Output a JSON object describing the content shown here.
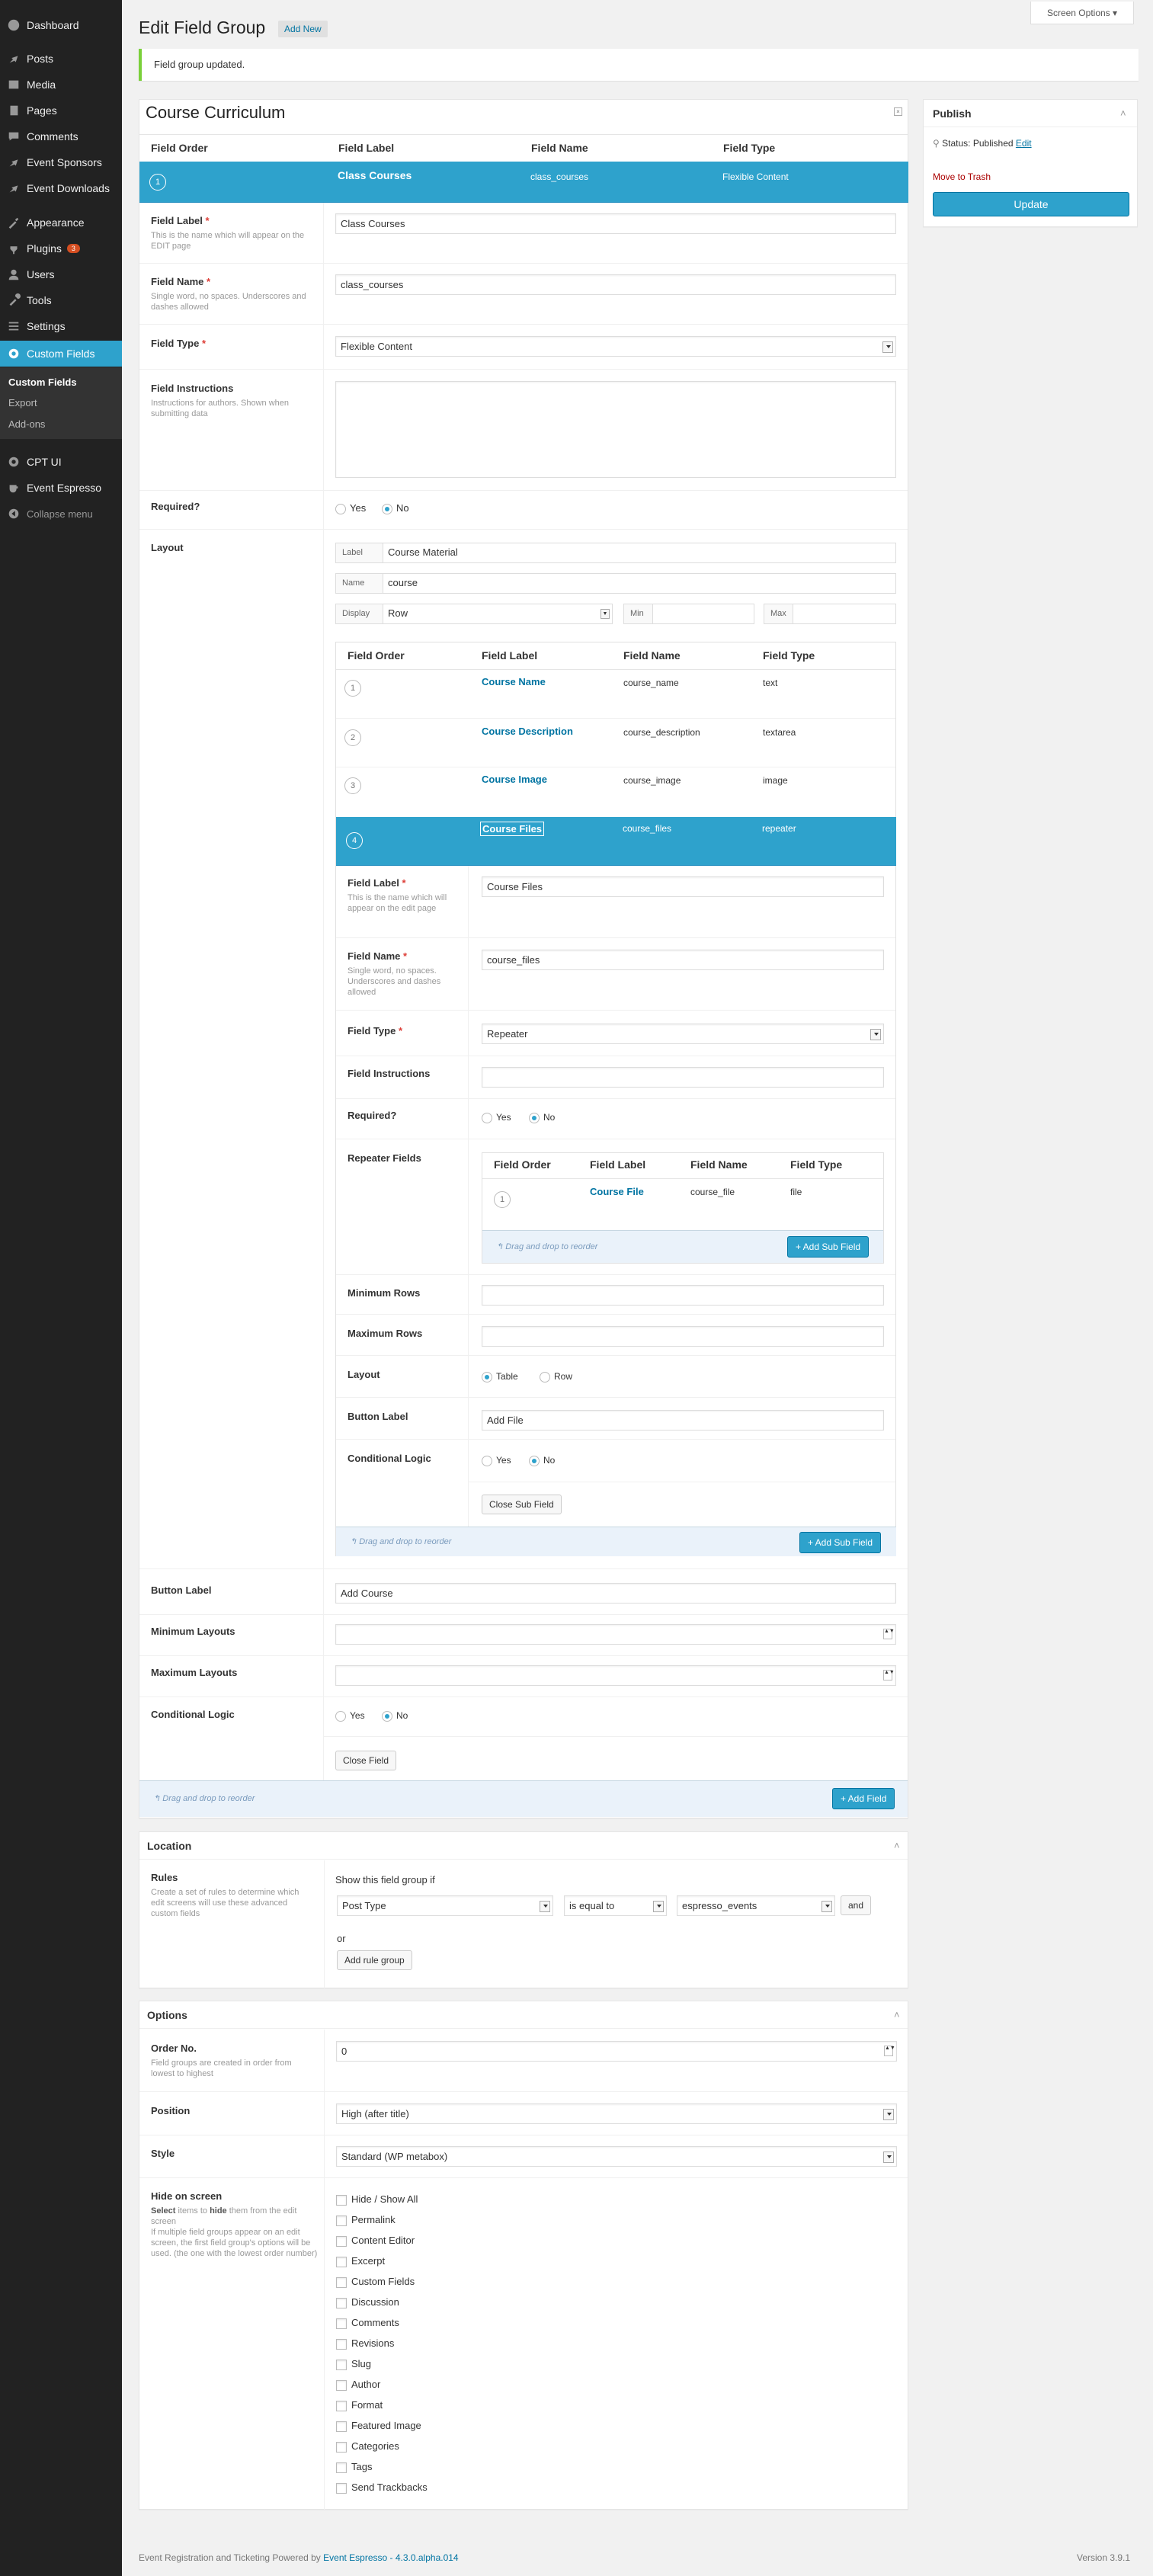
{
  "menu": {
    "items": [
      {
        "label": "Dashboard",
        "icon": "dashboard-icon"
      },
      {
        "label": "Posts",
        "icon": "pin-icon"
      },
      {
        "label": "Media",
        "icon": "media-icon"
      },
      {
        "label": "Pages",
        "icon": "pages-icon"
      },
      {
        "label": "Comments",
        "icon": "comments-icon"
      },
      {
        "label": "Event Sponsors",
        "icon": "pin-icon"
      },
      {
        "label": "Event Downloads",
        "icon": "pin-icon"
      },
      {
        "label": "Appearance",
        "icon": "appearance-icon"
      },
      {
        "label": "Plugins",
        "icon": "plugins-icon",
        "badge": "3"
      },
      {
        "label": "Users",
        "icon": "users-icon"
      },
      {
        "label": "Tools",
        "icon": "tools-icon"
      },
      {
        "label": "Settings",
        "icon": "settings-icon"
      },
      {
        "label": "Custom Fields",
        "icon": "gear-icon"
      },
      {
        "label": "CPT UI",
        "icon": "gear-icon"
      },
      {
        "label": "Event Espresso",
        "icon": "espresso-icon"
      },
      {
        "label": "Collapse menu",
        "icon": "collapse-icon"
      }
    ],
    "sub": [
      "Custom Fields",
      "Export",
      "Add-ons"
    ]
  },
  "header": {
    "title": "Edit Field Group",
    "add_new": "Add New",
    "screen_options": "Screen Options"
  },
  "notice": "Field group updated.",
  "group_title": "Course Curriculum",
  "fields_table": {
    "headers": [
      "Field Order",
      "Field Label",
      "Field Name",
      "Field Type"
    ],
    "row": {
      "order": "1",
      "label": "Class Courses",
      "name": "class_courses",
      "type": "Flexible Content"
    }
  },
  "field": {
    "label_lbl": "Field Label",
    "label_desc": "This is the name which will appear on the EDIT page",
    "label_val": "Class Courses",
    "name_lbl": "Field Name",
    "name_desc": "Single word, no spaces. Underscores and dashes allowed",
    "name_val": "class_courses",
    "type_lbl": "Field Type",
    "type_val": "Flexible Content",
    "instr_lbl": "Field Instructions",
    "instr_desc": "Instructions for authors. Shown when submitting data",
    "required_lbl": "Required?",
    "yes": "Yes",
    "no": "No",
    "layout_lbl": "Layout",
    "layout_label_lbl": "Label",
    "layout_label_val": "Course Material",
    "layout_name_lbl": "Name",
    "layout_name_val": "course",
    "display_lbl": "Display",
    "display_val": "Row",
    "min_lbl": "Min",
    "max_lbl": "Max",
    "sub_fields": [
      {
        "order": "1",
        "label": "Course Name",
        "name": "course_name",
        "type": "text"
      },
      {
        "order": "2",
        "label": "Course Description",
        "name": "course_description",
        "type": "textarea"
      },
      {
        "order": "3",
        "label": "Course Image",
        "name": "course_image",
        "type": "image"
      },
      {
        "order": "4",
        "label": "Course Files",
        "name": "course_files",
        "type": "repeater"
      }
    ],
    "sub": {
      "label_lbl": "Field Label",
      "label_desc": "This is the name which will appear on the edit page",
      "label_val": "Course Files",
      "name_lbl": "Field Name",
      "name_desc": "Single word, no spaces. Underscores and dashes allowed",
      "name_val": "course_files",
      "type_lbl": "Field Type",
      "type_val": "Repeater",
      "instr_lbl": "Field Instructions",
      "required_lbl": "Required?",
      "repeater_lbl": "Repeater Fields",
      "rep_row": {
        "order": "1",
        "label": "Course File",
        "name": "course_file",
        "type": "file"
      },
      "drag": "Drag and drop to reorder",
      "add_sub": "+ Add Sub Field",
      "min_rows": "Minimum Rows",
      "max_rows": "Maximum Rows",
      "layout_lbl": "Layout",
      "table": "Table",
      "row": "Row",
      "button_lbl": "Button Label",
      "button_val": "Add File",
      "cond_lbl": "Conditional Logic",
      "close": "Close Sub Field"
    },
    "drag": "Drag and drop to reorder",
    "add_sub": "+ Add Sub Field",
    "button_lbl": "Button Label",
    "button_val": "Add Course",
    "min_layouts": "Minimum Layouts",
    "max_layouts": "Maximum Layouts",
    "cond_lbl": "Conditional Logic",
    "close": "Close Field"
  },
  "group_footer": {
    "drag": "Drag and drop to reorder",
    "add_field": "+ Add Field"
  },
  "location": {
    "title": "Location",
    "rules_lbl": "Rules",
    "rules_desc": "Create a set of rules to determine which edit screens will use these advanced custom fields",
    "show_if": "Show this field group if",
    "param": "Post Type",
    "op": "is equal to",
    "value": "espresso_events",
    "and": "and",
    "or": "or",
    "add_rule_group": "Add rule group"
  },
  "options": {
    "title": "Options",
    "order_lbl": "Order No.",
    "order_desc": "Field groups are created in order from lowest to highest",
    "order_val": "0",
    "position_lbl": "Position",
    "position_val": "High (after title)",
    "style_lbl": "Style",
    "style_val": "Standard (WP metabox)",
    "hide_lbl": "Hide on screen",
    "hide_desc1": "Select",
    "hide_desc1b": "items to",
    "hide_desc1c": "hide",
    "hide_desc1d": "them from the edit screen",
    "hide_desc2": "If multiple field groups appear on an edit screen, the first field group's options will be used. (the one with the lowest order number)",
    "hide_items": [
      "Hide / Show All",
      "Permalink",
      "Content Editor",
      "Excerpt",
      "Custom Fields",
      "Discussion",
      "Comments",
      "Revisions",
      "Slug",
      "Author",
      "Format",
      "Featured Image",
      "Categories",
      "Tags",
      "Send Trackbacks"
    ]
  },
  "publish": {
    "title": "Publish",
    "status_lbl": "Status:",
    "status_val": "Published",
    "edit": "Edit",
    "trash": "Move to Trash",
    "update": "Update"
  },
  "footer": {
    "left": "Event Registration and Ticketing Powered by",
    "link": "Event Espresso - 4.3.0.alpha.014",
    "version": "Version 3.9.1"
  }
}
